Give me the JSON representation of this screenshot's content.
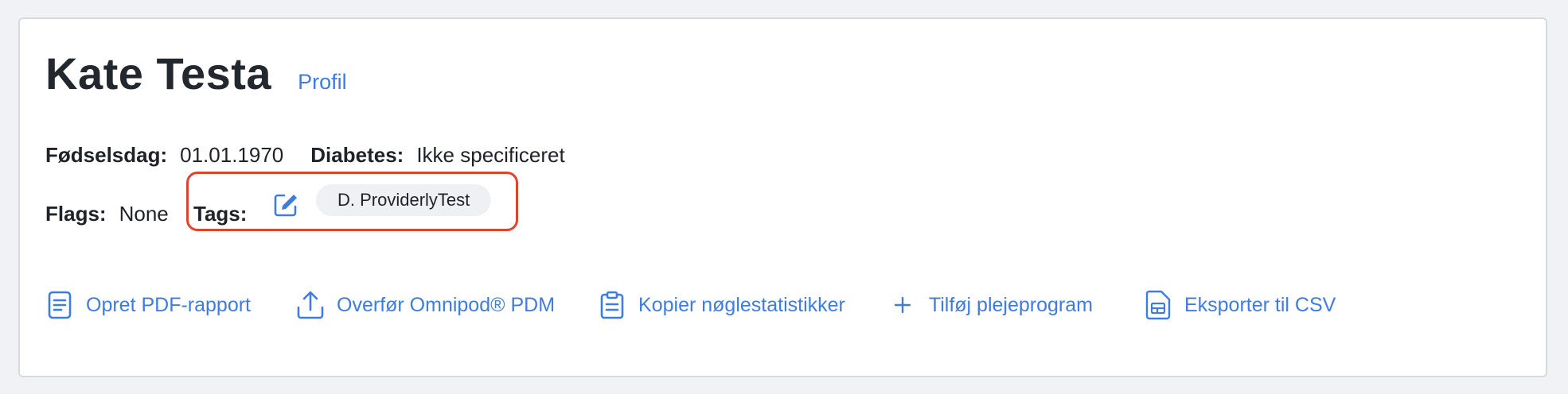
{
  "patient": {
    "name": "Kate Testa",
    "profile_link": "Profil"
  },
  "details": {
    "birthday_label": "Fødselsdag:",
    "birthday_value": "01.01.1970",
    "diabetes_label": "Diabetes:",
    "diabetes_value": "Ikke specificeret",
    "flags_label": "Flags:",
    "flags_value": "None",
    "tags_label": "Tags:",
    "tags": [
      "D. ProviderlyTest"
    ]
  },
  "actions": [
    {
      "label": "Opret PDF-rapport",
      "icon": "document-icon"
    },
    {
      "label": "Overfør Omnipod® PDM",
      "icon": "upload-icon"
    },
    {
      "label": "Kopier nøglestatistikker",
      "icon": "clipboard-icon"
    },
    {
      "label": "Tilføj plejeprogram",
      "icon": "plus-icon"
    },
    {
      "label": "Eksporter til CSV",
      "icon": "spreadsheet-file-icon"
    }
  ],
  "colors": {
    "accent": "#3f7ce0",
    "highlight": "#e0432f",
    "chip_bg": "#eef0f3",
    "text": "#1f2329"
  }
}
